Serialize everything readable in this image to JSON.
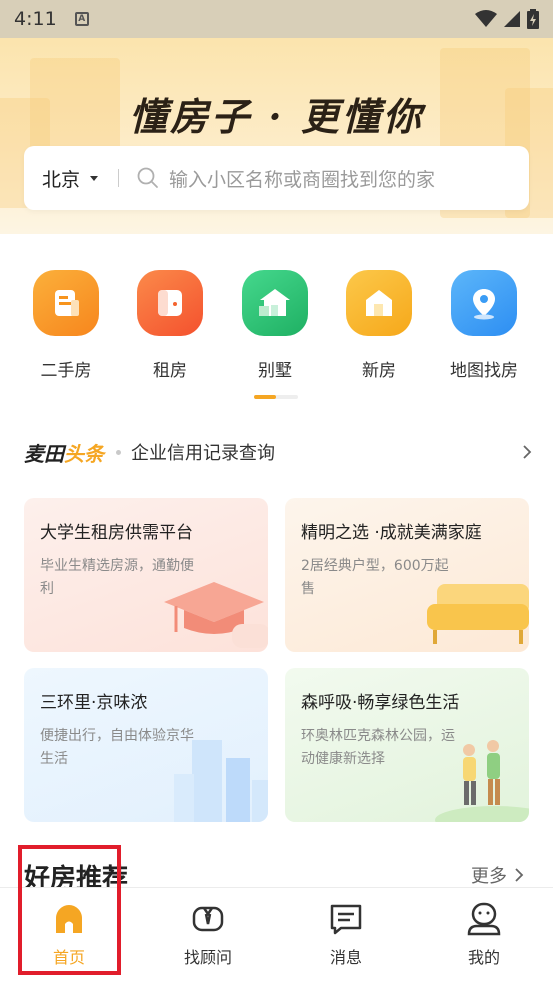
{
  "status_bar": {
    "time": "4:11",
    "indicator": "A"
  },
  "hero": {
    "title": "懂房子 · 更懂你",
    "search": {
      "city": "北京",
      "placeholder": "输入小区名称或商圈找到您的家"
    }
  },
  "categories": [
    {
      "label": "二手房",
      "icon": "second-hand-house-icon",
      "color": "#f7941d"
    },
    {
      "label": "租房",
      "icon": "rent-icon",
      "color": "#f4632e"
    },
    {
      "label": "别墅",
      "icon": "villa-icon",
      "color": "#2fc276"
    },
    {
      "label": "新房",
      "icon": "new-house-icon",
      "color": "#f8b11c"
    },
    {
      "label": "地图找房",
      "icon": "map-pin-icon",
      "color": "#3a9cf5"
    }
  ],
  "news": {
    "brand_part1": "麦田",
    "brand_part2": "头条",
    "text": "企业信用记录查询"
  },
  "promo_cards": [
    {
      "title": "大学生租房供需平台",
      "desc": "毕业生精选房源，通勤便利",
      "bg": "#fdebe6"
    },
    {
      "title": "精明之选 ·成就美满家庭",
      "desc": "2居经典户型，600万起售",
      "bg": "#fdf0e2"
    },
    {
      "title": "三环里·京味浓",
      "desc": "便捷出行，自由体验京华生活",
      "bg": "#e9f4fd"
    },
    {
      "title": "森呼吸·畅享绿色生活",
      "desc": "环奥林匹克森林公园，运动健康新选择",
      "bg": "#ecf7e9"
    }
  ],
  "recommend": {
    "title": "好房推荐",
    "more": "更多"
  },
  "tabbar": [
    {
      "label": "首页",
      "icon": "home-icon",
      "active": true
    },
    {
      "label": "找顾问",
      "icon": "advisor-icon",
      "active": false
    },
    {
      "label": "消息",
      "icon": "message-icon",
      "active": false
    },
    {
      "label": "我的",
      "icon": "profile-icon",
      "active": false
    }
  ],
  "colors": {
    "accent": "#f5a623",
    "highlight": "#e11d2b"
  }
}
